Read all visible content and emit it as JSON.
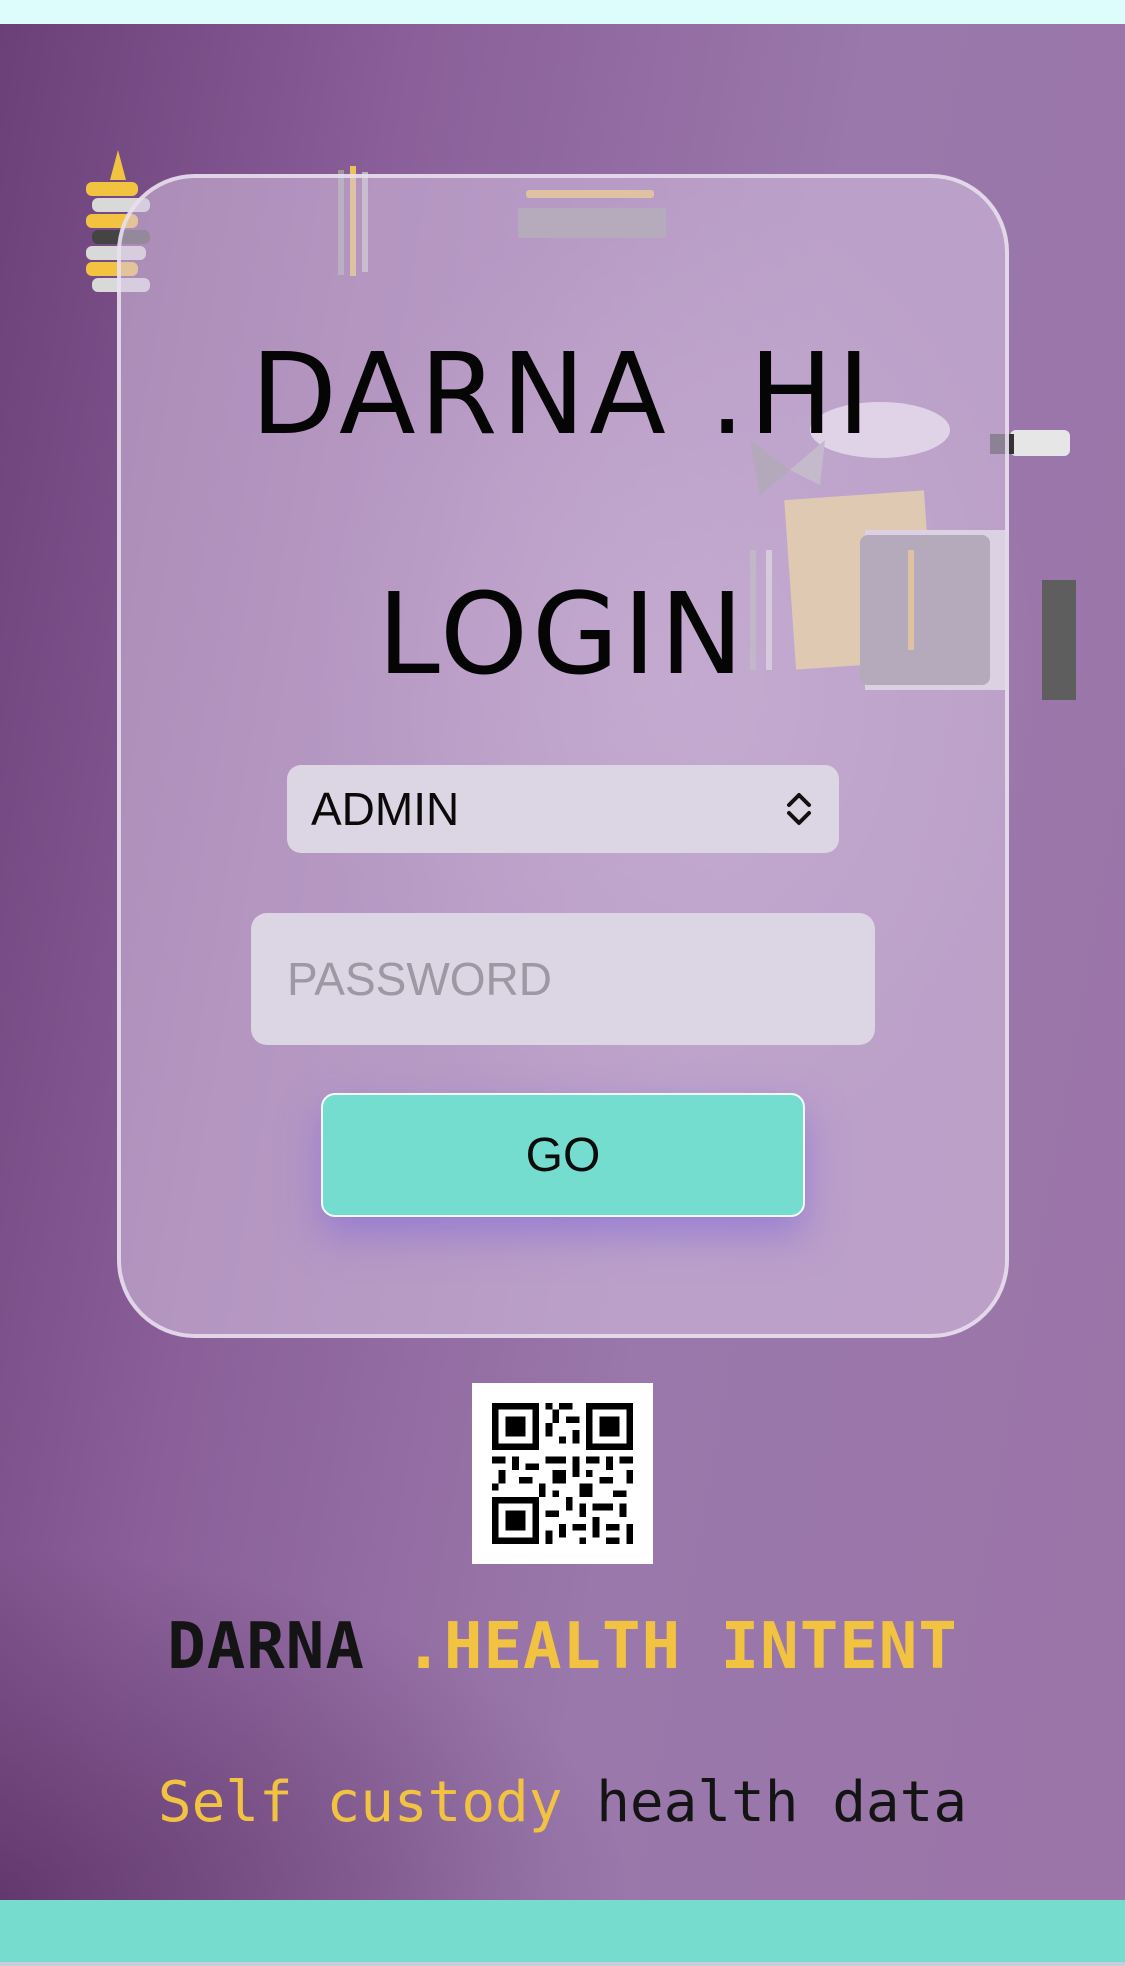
{
  "brand": {
    "title": "DARNA .HI"
  },
  "login": {
    "heading": "LOGIN",
    "role_select": {
      "value": "ADMIN"
    },
    "password": {
      "placeholder": "PASSWORD",
      "value": ""
    },
    "go_label": "GO"
  },
  "footer": {
    "brand_dark": "DARNA",
    "brand_gold": ".HEALTH INTENT",
    "tagline_gold": "Self custody",
    "tagline_dark": "health data"
  },
  "colors": {
    "accent_teal": "#75ddcf",
    "gold": "#f1c340",
    "background_purple": "#8a5f99"
  },
  "icons": [
    "qr-code-icon",
    "select-chevrons-icon"
  ]
}
